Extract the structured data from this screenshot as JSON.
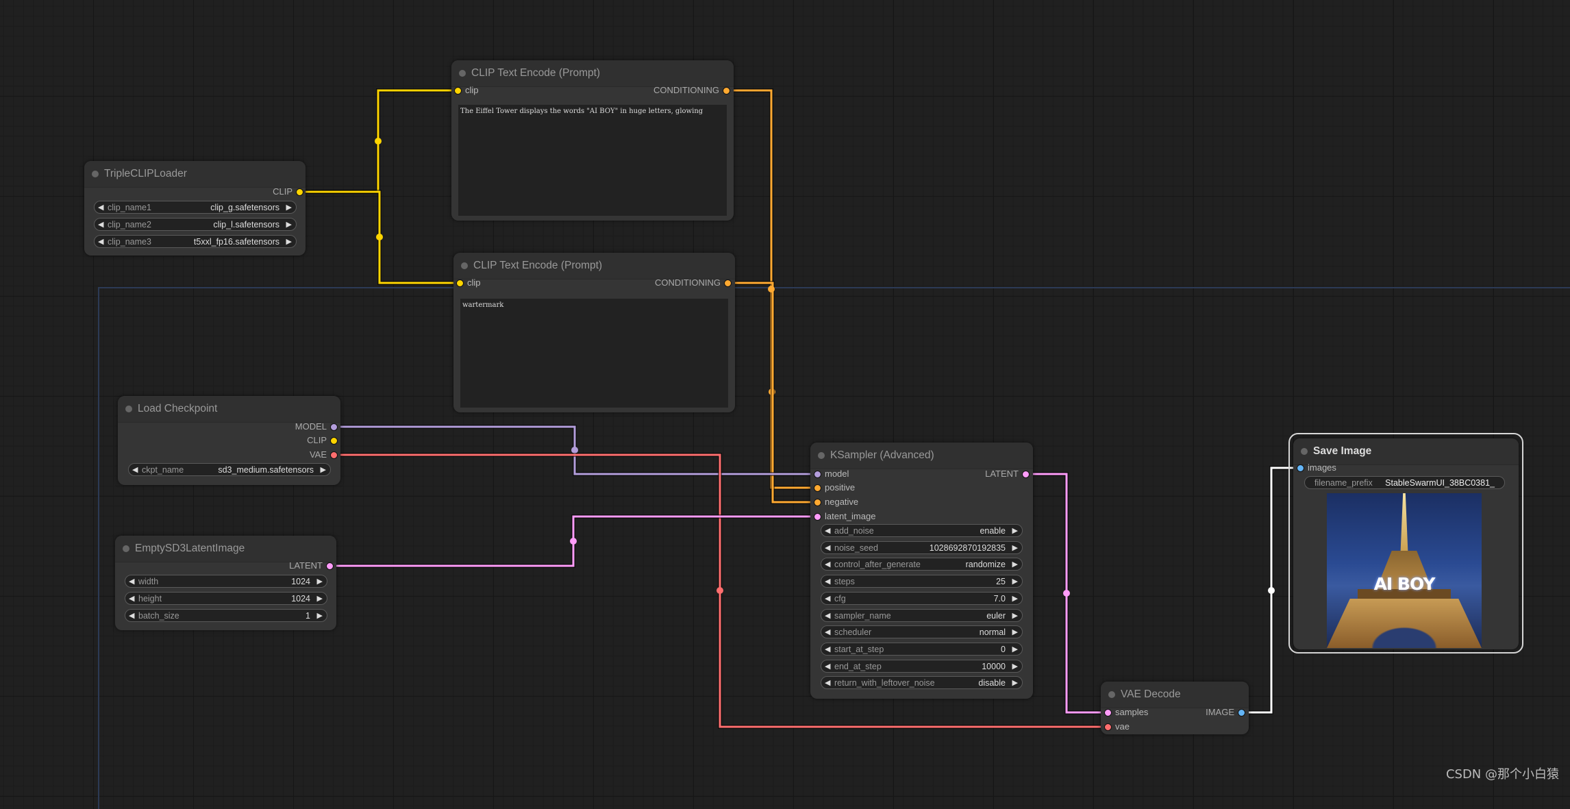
{
  "app": "ComfyUI node graph",
  "colors": {
    "clip": "#ffd500",
    "conditioning": "#ffa931",
    "model": "#b39ddb",
    "vae": "#ff6e6e",
    "latent": "#ff9cf9",
    "image": "#64b5f6",
    "image_wire": "#ffffff"
  },
  "nodes": {
    "triple_clip_loader": {
      "title": "TripleCLIPLoader",
      "outputs": [
        "CLIP"
      ],
      "widgets": [
        {
          "label": "clip_name1",
          "value": "clip_g.safetensors"
        },
        {
          "label": "clip_name2",
          "value": "clip_l.safetensors"
        },
        {
          "label": "clip_name3",
          "value": "t5xxl_fp16.safetensors"
        }
      ]
    },
    "clip_text_encode_positive": {
      "title": "CLIP Text Encode (Prompt)",
      "inputs": [
        "clip"
      ],
      "outputs": [
        "CONDITIONING"
      ],
      "text": "The Eiffel Tower displays the words \"AI BOY\" in huge letters, glowing"
    },
    "clip_text_encode_negative": {
      "title": "CLIP Text Encode (Prompt)",
      "inputs": [
        "clip"
      ],
      "outputs": [
        "CONDITIONING"
      ],
      "text": "wartermark"
    },
    "load_checkpoint": {
      "title": "Load Checkpoint",
      "outputs": [
        "MODEL",
        "CLIP",
        "VAE"
      ],
      "widgets": [
        {
          "label": "ckpt_name",
          "value": "sd3_medium.safetensors"
        }
      ]
    },
    "empty_sd3_latent": {
      "title": "EmptySD3LatentImage",
      "outputs": [
        "LATENT"
      ],
      "widgets": [
        {
          "label": "width",
          "value": "1024"
        },
        {
          "label": "height",
          "value": "1024"
        },
        {
          "label": "batch_size",
          "value": "1"
        }
      ]
    },
    "ksampler_advanced": {
      "title": "KSampler (Advanced)",
      "inputs": [
        "model",
        "positive",
        "negative",
        "latent_image"
      ],
      "outputs": [
        "LATENT"
      ],
      "widgets": [
        {
          "label": "add_noise",
          "value": "enable"
        },
        {
          "label": "noise_seed",
          "value": "1028692870192835"
        },
        {
          "label": "control_after_generate",
          "value": "randomize"
        },
        {
          "label": "steps",
          "value": "25"
        },
        {
          "label": "cfg",
          "value": "7.0"
        },
        {
          "label": "sampler_name",
          "value": "euler"
        },
        {
          "label": "scheduler",
          "value": "normal"
        },
        {
          "label": "start_at_step",
          "value": "0"
        },
        {
          "label": "end_at_step",
          "value": "10000"
        },
        {
          "label": "return_with_leftover_noise",
          "value": "disable"
        }
      ]
    },
    "vae_decode": {
      "title": "VAE Decode",
      "inputs": [
        "samples",
        "vae"
      ],
      "outputs": [
        "IMAGE"
      ]
    },
    "save_image": {
      "title": "Save Image",
      "inputs": [
        "images"
      ],
      "widgets": [
        {
          "label": "filename_prefix",
          "value": "StableSwarmUI_38BC0381_"
        }
      ],
      "preview_caption": "AI BOY"
    }
  },
  "links": [
    {
      "from": "triple_clip_loader.CLIP",
      "to": "clip_text_encode_positive.clip",
      "type": "clip"
    },
    {
      "from": "triple_clip_loader.CLIP",
      "to": "clip_text_encode_negative.clip",
      "type": "clip"
    },
    {
      "from": "clip_text_encode_positive.CONDITIONING",
      "to": "ksampler_advanced.positive",
      "type": "conditioning"
    },
    {
      "from": "clip_text_encode_negative.CONDITIONING",
      "to": "ksampler_advanced.negative",
      "type": "conditioning"
    },
    {
      "from": "load_checkpoint.MODEL",
      "to": "ksampler_advanced.model",
      "type": "model"
    },
    {
      "from": "load_checkpoint.VAE",
      "to": "vae_decode.vae",
      "type": "vae"
    },
    {
      "from": "empty_sd3_latent.LATENT",
      "to": "ksampler_advanced.latent_image",
      "type": "latent"
    },
    {
      "from": "ksampler_advanced.LATENT",
      "to": "vae_decode.samples",
      "type": "latent"
    },
    {
      "from": "vae_decode.IMAGE",
      "to": "save_image.images",
      "type": "image_wire"
    }
  ],
  "watermark": "CSDN @那个小白猿"
}
